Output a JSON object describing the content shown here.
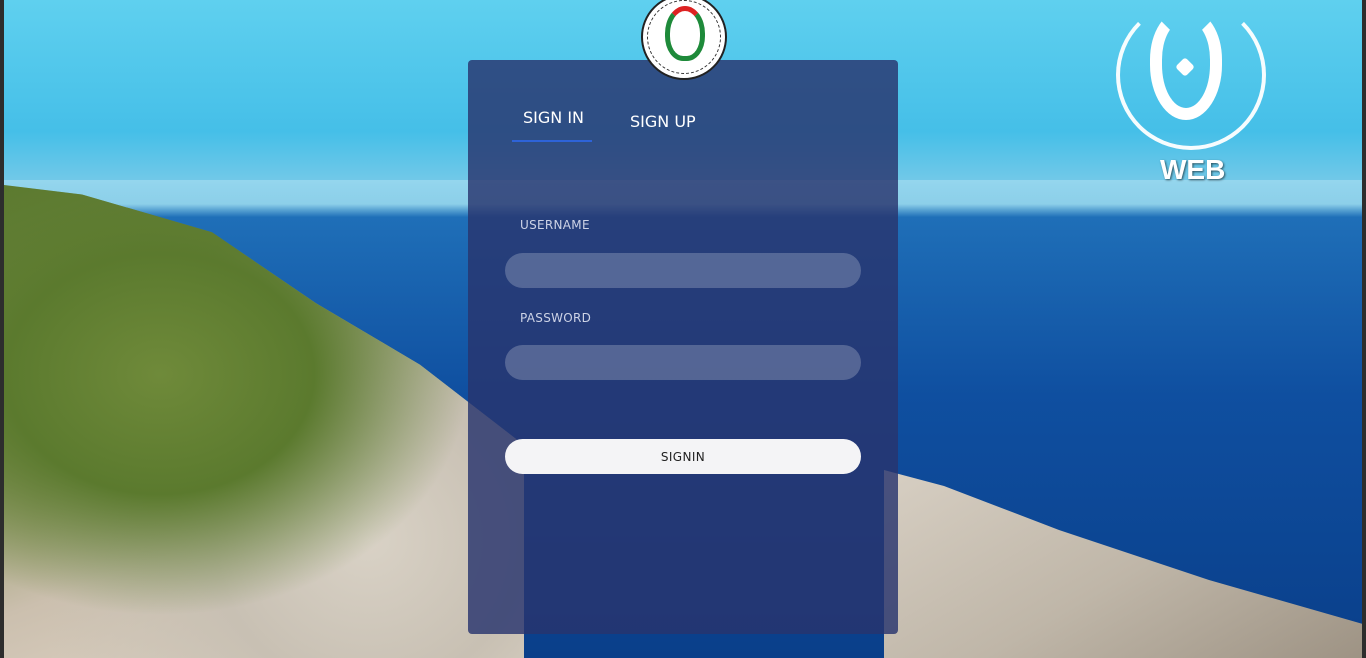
{
  "tabs": {
    "signin": "SIGN IN",
    "signup": "SIGN UP"
  },
  "form": {
    "username_label": "USERNAME",
    "password_label": "PASSWORD",
    "username_value": "",
    "password_value": "",
    "submit_label": "SIGNIN"
  },
  "branding": {
    "web_label": "WEB"
  },
  "colors": {
    "panel": "#28346e",
    "tab_underline": "#2e63d8",
    "button": "#f4f4f6"
  }
}
